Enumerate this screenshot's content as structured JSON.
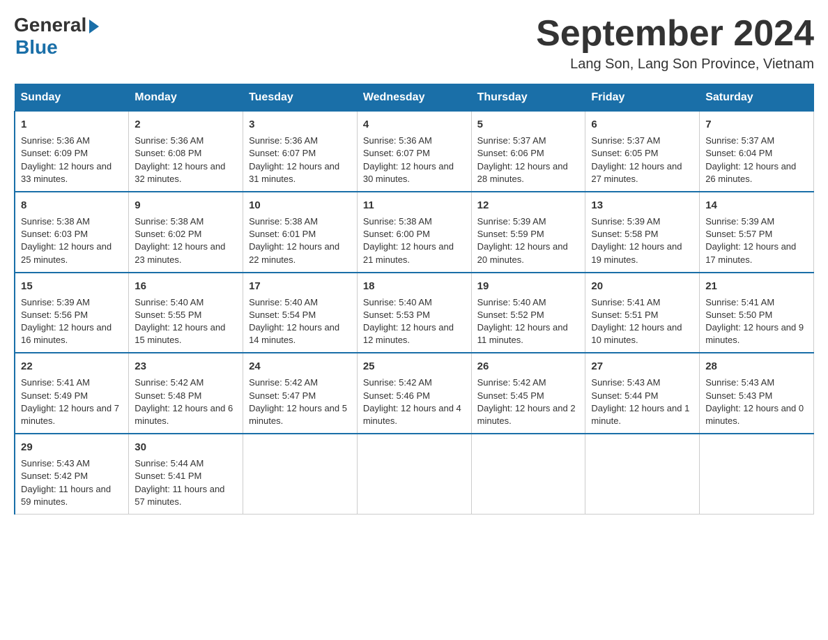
{
  "logo": {
    "general": "General",
    "blue": "Blue"
  },
  "title": "September 2024",
  "subtitle": "Lang Son, Lang Son Province, Vietnam",
  "days_of_week": [
    "Sunday",
    "Monday",
    "Tuesday",
    "Wednesday",
    "Thursday",
    "Friday",
    "Saturday"
  ],
  "weeks": [
    [
      {
        "day": "1",
        "sunrise": "Sunrise: 5:36 AM",
        "sunset": "Sunset: 6:09 PM",
        "daylight": "Daylight: 12 hours and 33 minutes."
      },
      {
        "day": "2",
        "sunrise": "Sunrise: 5:36 AM",
        "sunset": "Sunset: 6:08 PM",
        "daylight": "Daylight: 12 hours and 32 minutes."
      },
      {
        "day": "3",
        "sunrise": "Sunrise: 5:36 AM",
        "sunset": "Sunset: 6:07 PM",
        "daylight": "Daylight: 12 hours and 31 minutes."
      },
      {
        "day": "4",
        "sunrise": "Sunrise: 5:36 AM",
        "sunset": "Sunset: 6:07 PM",
        "daylight": "Daylight: 12 hours and 30 minutes."
      },
      {
        "day": "5",
        "sunrise": "Sunrise: 5:37 AM",
        "sunset": "Sunset: 6:06 PM",
        "daylight": "Daylight: 12 hours and 28 minutes."
      },
      {
        "day": "6",
        "sunrise": "Sunrise: 5:37 AM",
        "sunset": "Sunset: 6:05 PM",
        "daylight": "Daylight: 12 hours and 27 minutes."
      },
      {
        "day": "7",
        "sunrise": "Sunrise: 5:37 AM",
        "sunset": "Sunset: 6:04 PM",
        "daylight": "Daylight: 12 hours and 26 minutes."
      }
    ],
    [
      {
        "day": "8",
        "sunrise": "Sunrise: 5:38 AM",
        "sunset": "Sunset: 6:03 PM",
        "daylight": "Daylight: 12 hours and 25 minutes."
      },
      {
        "day": "9",
        "sunrise": "Sunrise: 5:38 AM",
        "sunset": "Sunset: 6:02 PM",
        "daylight": "Daylight: 12 hours and 23 minutes."
      },
      {
        "day": "10",
        "sunrise": "Sunrise: 5:38 AM",
        "sunset": "Sunset: 6:01 PM",
        "daylight": "Daylight: 12 hours and 22 minutes."
      },
      {
        "day": "11",
        "sunrise": "Sunrise: 5:38 AM",
        "sunset": "Sunset: 6:00 PM",
        "daylight": "Daylight: 12 hours and 21 minutes."
      },
      {
        "day": "12",
        "sunrise": "Sunrise: 5:39 AM",
        "sunset": "Sunset: 5:59 PM",
        "daylight": "Daylight: 12 hours and 20 minutes."
      },
      {
        "day": "13",
        "sunrise": "Sunrise: 5:39 AM",
        "sunset": "Sunset: 5:58 PM",
        "daylight": "Daylight: 12 hours and 19 minutes."
      },
      {
        "day": "14",
        "sunrise": "Sunrise: 5:39 AM",
        "sunset": "Sunset: 5:57 PM",
        "daylight": "Daylight: 12 hours and 17 minutes."
      }
    ],
    [
      {
        "day": "15",
        "sunrise": "Sunrise: 5:39 AM",
        "sunset": "Sunset: 5:56 PM",
        "daylight": "Daylight: 12 hours and 16 minutes."
      },
      {
        "day": "16",
        "sunrise": "Sunrise: 5:40 AM",
        "sunset": "Sunset: 5:55 PM",
        "daylight": "Daylight: 12 hours and 15 minutes."
      },
      {
        "day": "17",
        "sunrise": "Sunrise: 5:40 AM",
        "sunset": "Sunset: 5:54 PM",
        "daylight": "Daylight: 12 hours and 14 minutes."
      },
      {
        "day": "18",
        "sunrise": "Sunrise: 5:40 AM",
        "sunset": "Sunset: 5:53 PM",
        "daylight": "Daylight: 12 hours and 12 minutes."
      },
      {
        "day": "19",
        "sunrise": "Sunrise: 5:40 AM",
        "sunset": "Sunset: 5:52 PM",
        "daylight": "Daylight: 12 hours and 11 minutes."
      },
      {
        "day": "20",
        "sunrise": "Sunrise: 5:41 AM",
        "sunset": "Sunset: 5:51 PM",
        "daylight": "Daylight: 12 hours and 10 minutes."
      },
      {
        "day": "21",
        "sunrise": "Sunrise: 5:41 AM",
        "sunset": "Sunset: 5:50 PM",
        "daylight": "Daylight: 12 hours and 9 minutes."
      }
    ],
    [
      {
        "day": "22",
        "sunrise": "Sunrise: 5:41 AM",
        "sunset": "Sunset: 5:49 PM",
        "daylight": "Daylight: 12 hours and 7 minutes."
      },
      {
        "day": "23",
        "sunrise": "Sunrise: 5:42 AM",
        "sunset": "Sunset: 5:48 PM",
        "daylight": "Daylight: 12 hours and 6 minutes."
      },
      {
        "day": "24",
        "sunrise": "Sunrise: 5:42 AM",
        "sunset": "Sunset: 5:47 PM",
        "daylight": "Daylight: 12 hours and 5 minutes."
      },
      {
        "day": "25",
        "sunrise": "Sunrise: 5:42 AM",
        "sunset": "Sunset: 5:46 PM",
        "daylight": "Daylight: 12 hours and 4 minutes."
      },
      {
        "day": "26",
        "sunrise": "Sunrise: 5:42 AM",
        "sunset": "Sunset: 5:45 PM",
        "daylight": "Daylight: 12 hours and 2 minutes."
      },
      {
        "day": "27",
        "sunrise": "Sunrise: 5:43 AM",
        "sunset": "Sunset: 5:44 PM",
        "daylight": "Daylight: 12 hours and 1 minute."
      },
      {
        "day": "28",
        "sunrise": "Sunrise: 5:43 AM",
        "sunset": "Sunset: 5:43 PM",
        "daylight": "Daylight: 12 hours and 0 minutes."
      }
    ],
    [
      {
        "day": "29",
        "sunrise": "Sunrise: 5:43 AM",
        "sunset": "Sunset: 5:42 PM",
        "daylight": "Daylight: 11 hours and 59 minutes."
      },
      {
        "day": "30",
        "sunrise": "Sunrise: 5:44 AM",
        "sunset": "Sunset: 5:41 PM",
        "daylight": "Daylight: 11 hours and 57 minutes."
      },
      null,
      null,
      null,
      null,
      null
    ]
  ]
}
